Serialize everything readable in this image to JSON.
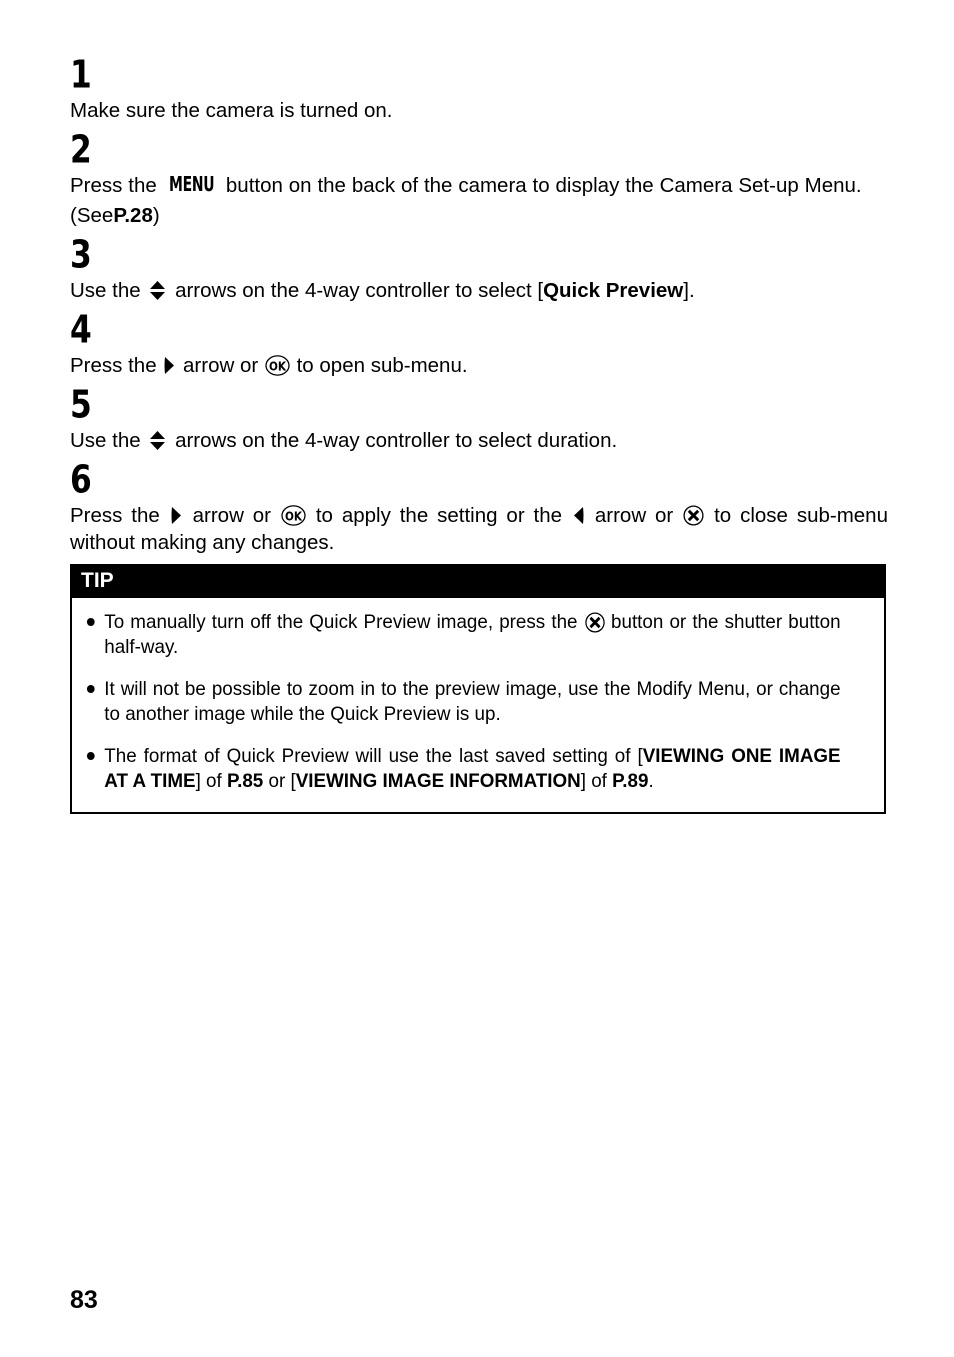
{
  "document": {
    "page_number": "83"
  },
  "steps": [
    {
      "number": "1",
      "text_before": "Make sure the camera is turned on.",
      "segments": [
        {
          "type": "text",
          "value": "Make sure the camera is turned on."
        }
      ]
    },
    {
      "number": "2",
      "segments": [
        {
          "type": "text",
          "value": "Press the "
        },
        {
          "type": "icon",
          "icon": "menu-button-icon",
          "label": "MENU"
        },
        {
          "type": "text",
          "value": " button on the back of the camera to display the Camera Set-up Menu. (See "
        },
        {
          "type": "bold",
          "value": "P.28"
        },
        {
          "type": "text",
          "value": ")"
        }
      ]
    },
    {
      "number": "3",
      "segments": [
        {
          "type": "text",
          "value": "Use the "
        },
        {
          "type": "icon",
          "icon": "up-down-arrow-icon",
          "label": "up/down arrows"
        },
        {
          "type": "text",
          "value": " arrows on the 4-way controller to select ["
        },
        {
          "type": "bold",
          "value": "Quick Preview"
        },
        {
          "type": "text",
          "value": "]."
        }
      ]
    },
    {
      "number": "4",
      "segments": [
        {
          "type": "text",
          "value": "Press the "
        },
        {
          "type": "icon",
          "icon": "right-arrow-icon",
          "label": "right arrow"
        },
        {
          "type": "text",
          "value": " arrow or "
        },
        {
          "type": "icon",
          "icon": "ok-button-icon",
          "label": "OK"
        },
        {
          "type": "text",
          "value": " to open sub-menu."
        }
      ]
    },
    {
      "number": "5",
      "segments": [
        {
          "type": "text",
          "value": "Use the "
        },
        {
          "type": "icon",
          "icon": "up-down-arrow-icon",
          "label": "up/down arrows"
        },
        {
          "type": "text",
          "value": " arrows on the 4-way controller to select duration."
        }
      ]
    },
    {
      "number": "6",
      "segments": [
        {
          "type": "text",
          "value": "Press the "
        },
        {
          "type": "icon",
          "icon": "right-arrow-icon",
          "label": "right arrow"
        },
        {
          "type": "text",
          "value": " arrow or "
        },
        {
          "type": "icon",
          "icon": "ok-button-icon",
          "label": "OK"
        },
        {
          "type": "text",
          "value": " to apply the setting or the "
        },
        {
          "type": "icon",
          "icon": "left-arrow-icon",
          "label": "left arrow"
        },
        {
          "type": "text",
          "value": " arrow or "
        },
        {
          "type": "icon",
          "icon": "cancel-button-icon",
          "label": "X"
        },
        {
          "type": "text",
          "value": " to close sub-menu without making any changes."
        }
      ]
    }
  ],
  "step_text": {
    "s1": "Make sure the camera is turned on.",
    "s2_a": "Press the",
    "s2_b": "button on the back of the camera to display the Camera Set-up Menu.",
    "s2_see": "(See",
    "s2_page": "P.28",
    "s2_close": ")",
    "s3_a": "Use the",
    "s3_b": "arrows on the 4-way controller to select [",
    "s3_bold": "Quick Preview",
    "s3_c": "].",
    "s4_a": "Press the",
    "s4_b": "arrow or",
    "s4_c": "to open sub-menu.",
    "s5_a": "Use the",
    "s5_b": "arrows on the 4-way controller to select duration.",
    "s6_a": "Press the",
    "s6_b": "arrow or",
    "s6_c": "to apply the setting or the",
    "s6_d": "arrow or",
    "s6_e": "to close sub-menu without making any changes."
  },
  "tip": {
    "header": "TIP",
    "items": [
      {
        "a": "To manually turn off the Quick Preview image, press the",
        "b": "button or the shutter button half-way."
      },
      {
        "a": "It will not be possible to zoom in to the preview image, use the Modify Menu, or change to another image while the Quick Preview is up."
      },
      {
        "a": "The format of Quick Preview will use the last saved setting of [",
        "bold1": "VIEWING ONE IMAGE AT A TIME",
        "b": "] of ",
        "bold2": "P.85",
        "c": " or [",
        "bold3": "VIEWING IMAGE INFORMATION",
        "d": "] of ",
        "bold4": "P.89",
        "e": "."
      }
    ]
  },
  "icons": {
    "menu_label": "MENU",
    "ok_label": "OK"
  },
  "numbers": {
    "one": "1",
    "two": "2",
    "three": "3",
    "four": "4",
    "five": "5",
    "six": "6"
  },
  "colors": {
    "ink": "#000000",
    "paper": "#ffffff",
    "tip_header_bg": "#000000",
    "tip_header_fg": "#ffffff"
  }
}
